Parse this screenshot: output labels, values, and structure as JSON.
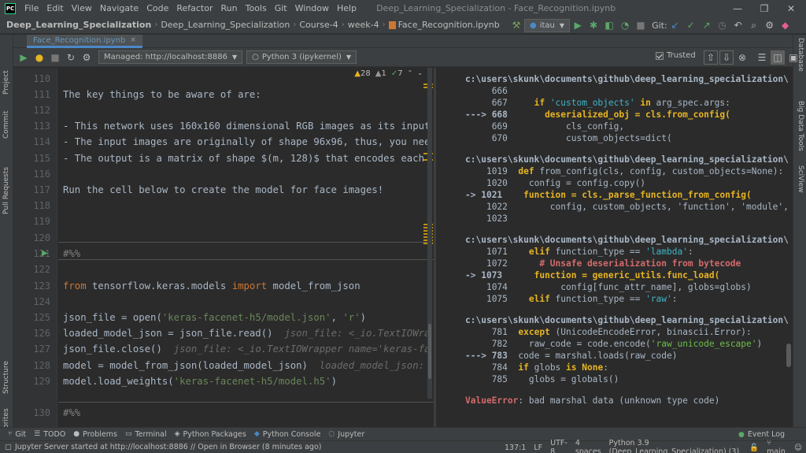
{
  "menubar": {
    "logo": "PC",
    "items": [
      "File",
      "Edit",
      "View",
      "Navigate",
      "Code",
      "Refactor",
      "Run",
      "Tools",
      "Git",
      "Window",
      "Help"
    ],
    "window_title": "Deep_Learning_Specialization - Face_Recognition.ipynb"
  },
  "navbar": {
    "breadcrumbs": [
      "Deep_Learning_Specialization",
      "Deep_Learning_Specialization",
      "Course-4",
      "week-4",
      "Face_Recognition.ipynb"
    ],
    "run_config": "itau",
    "git_label": "Git:"
  },
  "left_tools": [
    "Project",
    "Commit",
    "Pull Requests",
    "Structure",
    "Favorites"
  ],
  "right_tools": [
    "Database",
    "Big Data Tools",
    "SciView"
  ],
  "tab": {
    "label": "Face_Recognition.ipynb",
    "close": "×"
  },
  "nb_toolbar": {
    "server": "Managed: http://localhost:8886",
    "kernel": "Python 3 (ipykernel)",
    "trusted": "Trusted"
  },
  "inspections": {
    "warnings": "28",
    "weak": "1",
    "typos": "7"
  },
  "editor": {
    "lines": [
      {
        "n": "110",
        "t": ""
      },
      {
        "n": "111",
        "t": "The key things to be aware of are:"
      },
      {
        "n": "112",
        "t": ""
      },
      {
        "n": "113",
        "t": "- This network uses 160x160 dimensional RGB images as its input"
      },
      {
        "n": "114",
        "t": "- The input images are originally of shape 96x96, thus, you nee"
      },
      {
        "n": "115",
        "t": "- The output is a matrix of shape $(m, 128)$ that encodes each"
      },
      {
        "n": "116",
        "t": ""
      },
      {
        "n": "117",
        "t": "Run the cell below to create the model for face images!"
      },
      {
        "n": "118",
        "t": ""
      },
      {
        "n": "119",
        "t": ""
      },
      {
        "n": "120",
        "t": ""
      },
      {
        "n": "121",
        "t": "#%%"
      },
      {
        "n": "122",
        "t": ""
      },
      {
        "n": "123",
        "t": ""
      },
      {
        "n": "124",
        "t": ""
      },
      {
        "n": "125",
        "t": ""
      },
      {
        "n": "126",
        "t": ""
      },
      {
        "n": "127",
        "t": ""
      },
      {
        "n": "128",
        "t": ""
      },
      {
        "n": "129",
        "t": ""
      },
      {
        "n": "130",
        "t": "#%%"
      }
    ],
    "code": {
      "l123_kw1": "from",
      "l123_mod": " tensorflow.keras.models ",
      "l123_kw2": "import",
      "l123_fn": " model_from_json",
      "l125_a": "json_file = ",
      "l125_b": "open(",
      "l125_s1": "'keras-facenet-h5/model.json'",
      "l125_c": ", ",
      "l125_s2": "'r'",
      "l125_d": ")",
      "l126_a": "loaded_model_json = json_file.read()",
      "l126_h": "  json_file: <_io.TextIOWra",
      "l127_a": "json_file.close()",
      "l127_h": "  json_file: <_io.TextIOWrapper name='keras-fa",
      "l128_a": "model = model_from_json(loaded_model_json)",
      "l128_h": "  loaded_model_json:",
      "l129_a": "model.load_weights(",
      "l129_s": "'keras-facenet-h5/model.h5'",
      "l129_b": ")"
    }
  },
  "output": {
    "path": "c:\\users\\skunk\\documents\\github\\deep_learning_specialization\\",
    "b1": [
      {
        "n": "666",
        "pre": "     ",
        "t": ""
      },
      {
        "n": "667",
        "pre": "     ",
        "t": ""
      },
      {
        "n": "668",
        "pre": "---> ",
        "t": ""
      },
      {
        "n": "669",
        "pre": "     ",
        "t": ""
      },
      {
        "n": "670",
        "pre": "     ",
        "t": ""
      }
    ],
    "b1_l667_kw": "if ",
    "b1_l667_s": "'custom_objects'",
    "b1_l667_kw2": " in ",
    "b1_l667_rest": "arg_spec.args:",
    "b1_l668": "deserialized_obj = cls.from_config(",
    "b1_l669": "cls_config,",
    "b1_l670": "custom_objects=dict(",
    "b2_l1019_kw": "def ",
    "b2_l1019_rest": "from_config(cls, config, custom_objects=None):",
    "b2_l1020": "config = config.copy()",
    "b2_l1021_kw": "function",
    "b2_l1021_rest": " = cls._parse_function_from_config(",
    "b2_l1022": "config, custom_objects, 'function', 'module',",
    "b2_nums": [
      "1019",
      "1020",
      "1021",
      "1022",
      "1023"
    ],
    "b3_nums": [
      "1071",
      "1072",
      "1073",
      "1074",
      "1075"
    ],
    "b3_l1071_kw": "elif ",
    "b3_l1071_rest": "function_type == ",
    "b3_l1071_s": "'lambda'",
    "b3_l1071_end": ":",
    "b3_l1072": "# Unsafe deserialization from bytecode",
    "b3_l1073": "function = generic_utils.func_load(",
    "b3_l1074": "config[func_attr_name], globs=globs)",
    "b3_l1075_kw": "elif ",
    "b3_l1075_rest": "function_type == ",
    "b3_l1075_s": "'raw'",
    "b3_l1075_end": ":",
    "b4_nums": [
      "781",
      "782",
      "783",
      "784",
      "785"
    ],
    "b4_l781_kw": "except ",
    "b4_l781_rest": "(UnicodeEncodeError, binascii.Error):",
    "b4_l782_a": "raw_code = code.encode(",
    "b4_l782_s": "'raw_unicode_escape'",
    "b4_l782_b": ")",
    "b4_l783": "code = marshal.loads(raw_code)",
    "b4_l784_kw": "if ",
    "b4_l784_rest": "globs ",
    "b4_l784_kw2": "is None",
    "b4_l784_end": ":",
    "b4_l785": "globs = globals()",
    "error_name": "ValueError",
    "error_msg": ": bad marshal data (unknown type code)"
  },
  "toolstrip": [
    "Git",
    "TODO",
    "Problems",
    "Terminal",
    "Python Packages",
    "Python Console",
    "Jupyter"
  ],
  "event_log": "Event Log",
  "status": {
    "message": "Jupyter Server started at http://localhost:8886 // Open in Browser (8 minutes ago)",
    "position": "137:1",
    "line_sep": "LF",
    "encoding": "UTF-8",
    "indent": "4 spaces",
    "interpreter": "Python 3.9 (Deep_Learning_Specialization) (3)",
    "branch": "main"
  }
}
